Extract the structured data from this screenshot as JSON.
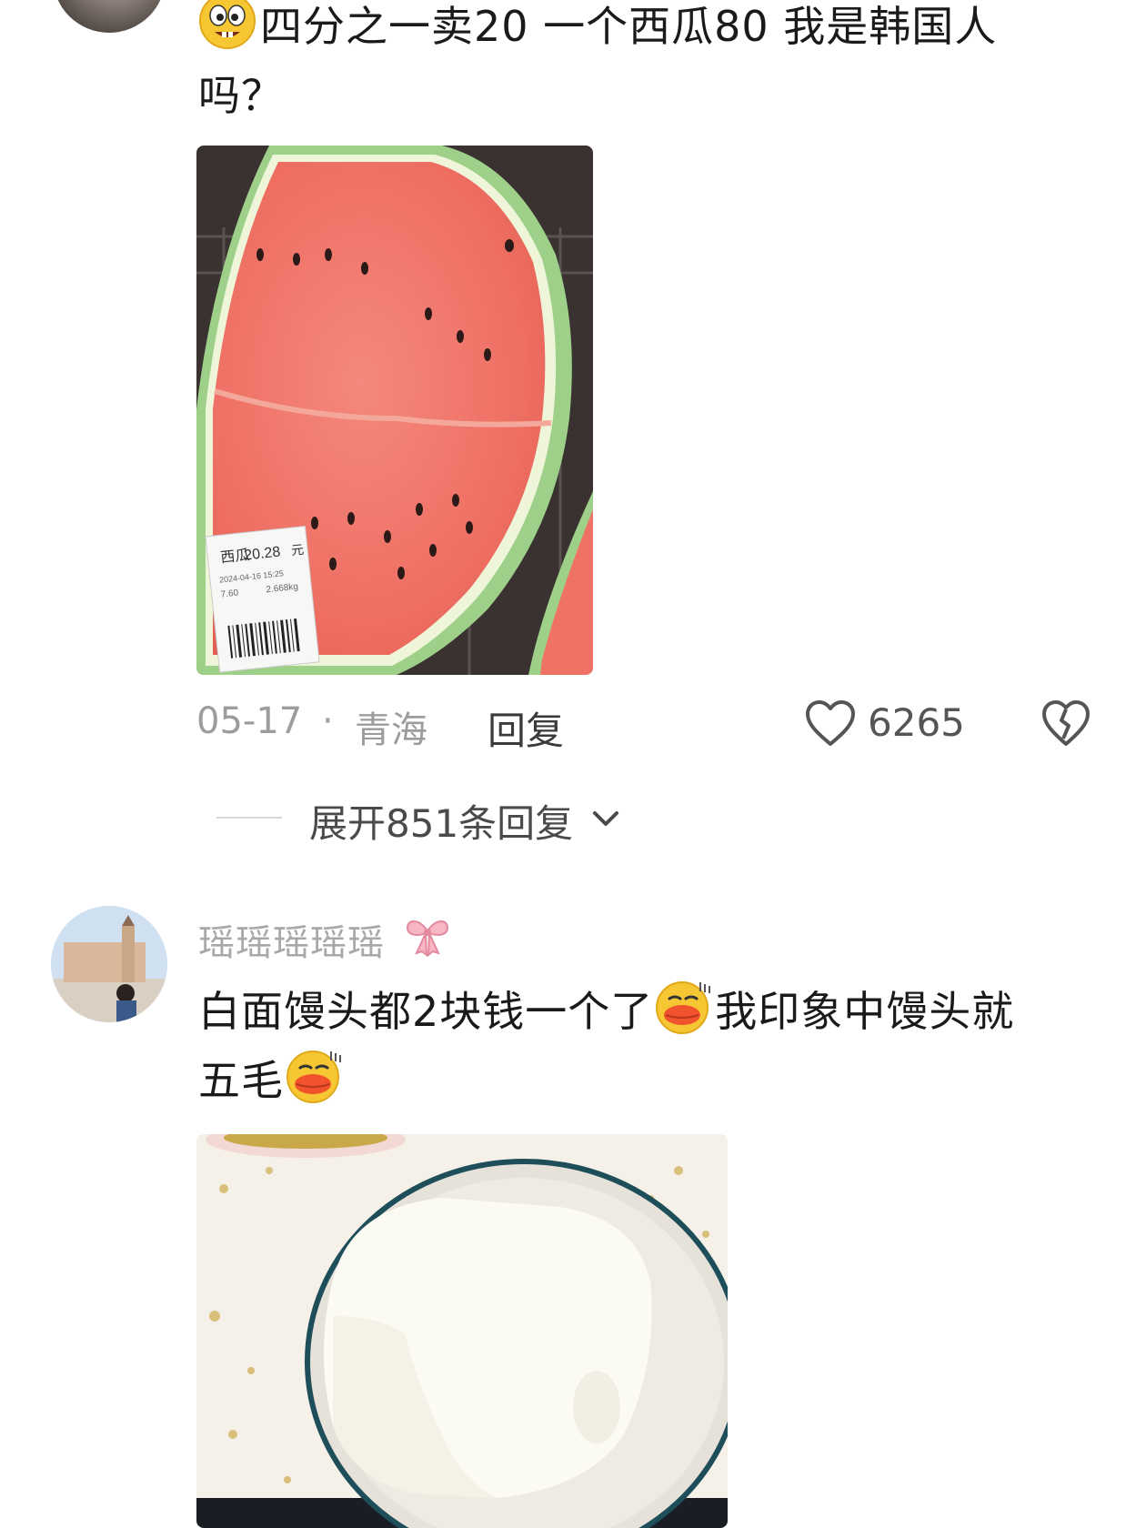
{
  "comments": [
    {
      "text_line1": "四分之一卖20  一个西瓜80  我是韩国人",
      "text_line2": "吗？",
      "meta": {
        "date": "05-17",
        "separator": "·",
        "location": "青海",
        "reply_label": "回复",
        "likes": "6265"
      },
      "expand_replies_label": "展开851条回复"
    },
    {
      "username": "瑶瑶瑶瑶瑶",
      "text_part1": "白面馒头都2块钱一个了",
      "text_part2": "我印象中馒头就",
      "text_part3": "五毛"
    }
  ],
  "price_label": {
    "name": "西瓜",
    "price": "20.28",
    "unit": "元",
    "date": "2024-04-16 15:25",
    "unit_price": "7.60",
    "weight": "2.668kg"
  },
  "colors": {
    "meta": "#9c9c9c",
    "text": "#1a1a1a",
    "username": "#a8a8a8"
  }
}
